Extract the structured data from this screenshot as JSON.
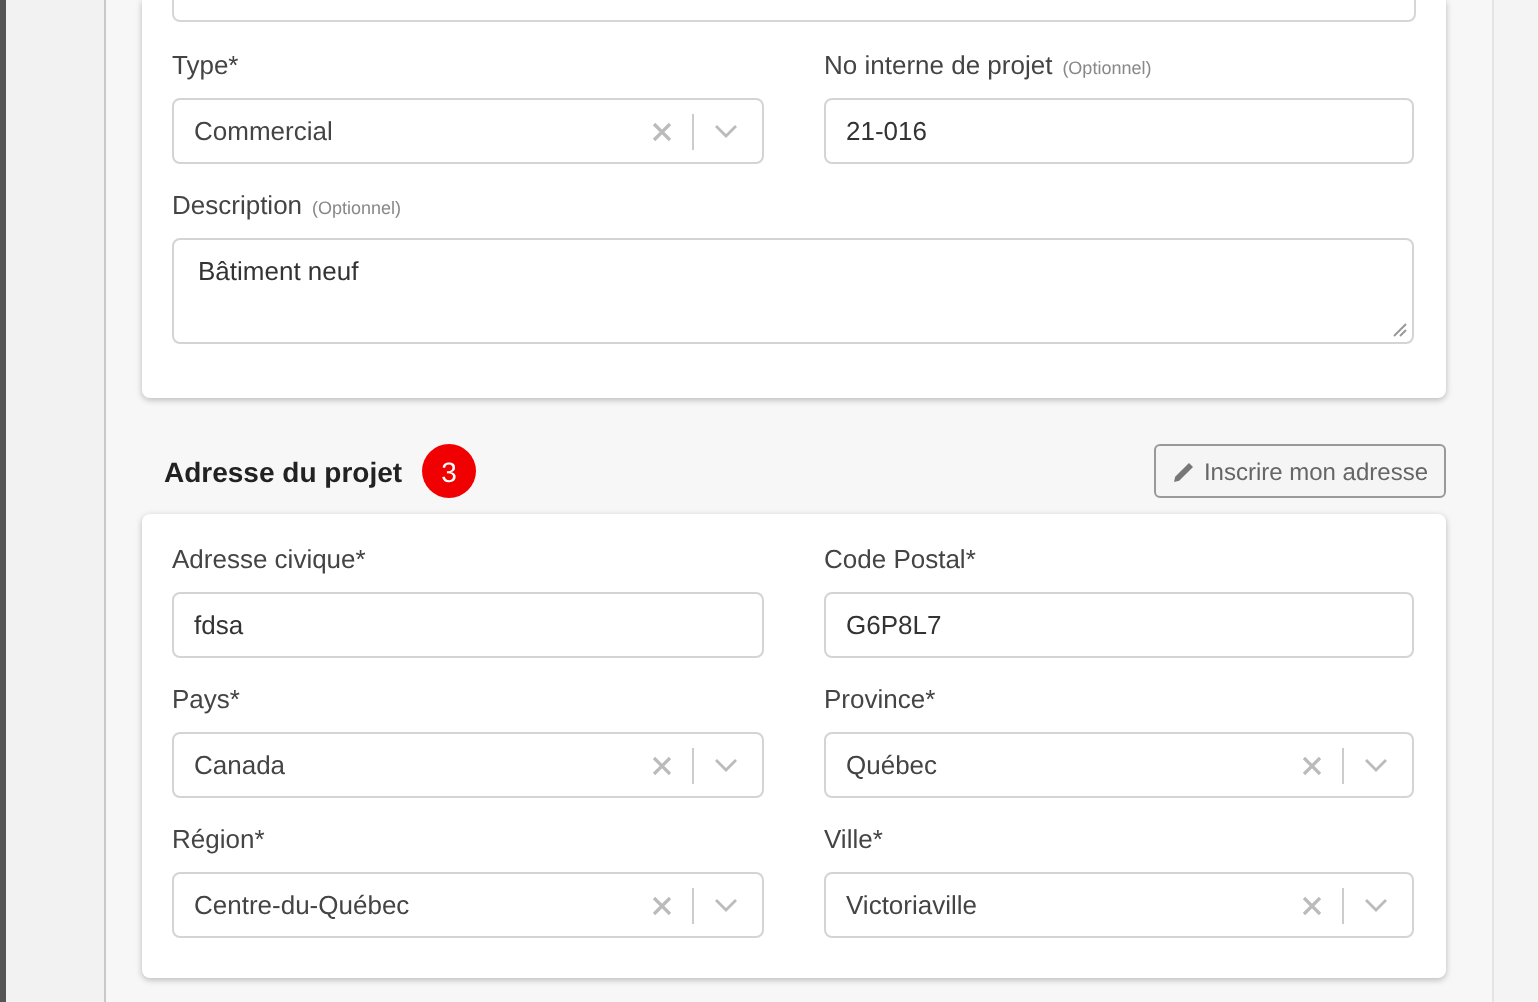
{
  "project_card": {
    "fields": [
      {
        "kind": "select",
        "label": "Type*",
        "value": "Commercial"
      },
      {
        "kind": "input",
        "label": "No interne de projet",
        "hint": "(Optionnel)",
        "value": "21-016"
      },
      {
        "kind": "textarea",
        "label": "Description",
        "hint": "(Optionnel)",
        "value": "Bâtiment neuf"
      }
    ]
  },
  "address_section": {
    "title": "Adresse du projet",
    "badge": "3",
    "button": "Inscrire mon adresse",
    "fields": [
      {
        "kind": "input",
        "label": "Adresse civique*",
        "value": "fdsa"
      },
      {
        "kind": "input",
        "label": "Code Postal*",
        "value": "G6P8L7"
      },
      {
        "kind": "select",
        "label": "Pays*",
        "value": "Canada"
      },
      {
        "kind": "select",
        "label": "Province*",
        "value": "Québec"
      },
      {
        "kind": "select",
        "label": "Région*",
        "value": "Centre-du-Québec"
      },
      {
        "kind": "select",
        "label": "Ville*",
        "value": "Victoriaville"
      }
    ]
  }
}
